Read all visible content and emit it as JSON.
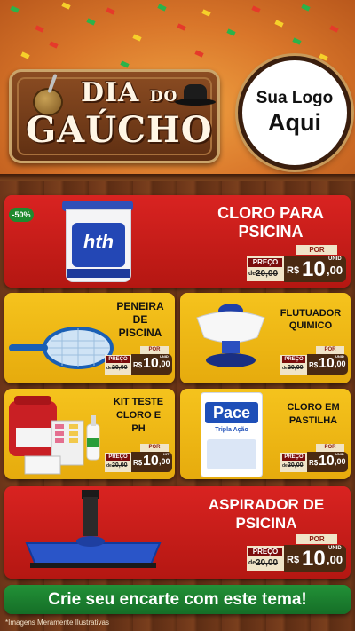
{
  "header": {
    "title_line1": "DIA",
    "title_small": "DO",
    "title_line2": "GAÚCHO",
    "logo_line1": "Sua Logo",
    "logo_line2": "Aqui"
  },
  "colors": {
    "red_card": "#d92321",
    "yellow_card": "#f5c31d",
    "green_button": "#229137",
    "wood": "#6b3519"
  },
  "products": [
    {
      "name_line1": "CLORO PARA",
      "name_line2": "PSICINA",
      "badge": "-50%",
      "por": "POR",
      "preco": "PREÇO",
      "de": "de",
      "old_price": "20,00",
      "currency": "R$",
      "price_int": "10",
      "price_dec": ",00",
      "unit": "UNID",
      "brand": "hth"
    },
    {
      "name_line1": "PENEIRA",
      "name_line2": "DE",
      "name_line3": "PISCINA",
      "por": "POR",
      "preco": "PREÇO",
      "de": "de",
      "old_price": "20,00",
      "currency": "R$",
      "price_int": "10",
      "price_dec": ",00",
      "unit": "UNID"
    },
    {
      "name_line1": "FLUTUADOR",
      "name_line2": "QUIMICO",
      "por": "POR",
      "preco": "PREÇO",
      "de": "de",
      "old_price": "20,00",
      "currency": "R$",
      "price_int": "10",
      "price_dec": ",00",
      "unit": "UNID"
    },
    {
      "name_line1": "KIT TESTE",
      "name_line2": "CLORO E",
      "name_line3": "PH",
      "por": "POR",
      "preco": "PREÇO",
      "de": "de",
      "old_price": "20,00",
      "currency": "R$",
      "price_int": "10",
      "price_dec": ",00",
      "unit": "KIT"
    },
    {
      "name_line1": "CLORO EM",
      "name_line2": "PASTILHA",
      "por": "POR",
      "preco": "PREÇO",
      "de": "de",
      "old_price": "20,00",
      "currency": "R$",
      "price_int": "10",
      "price_dec": ",00",
      "unit": "UNID",
      "brand": "Pace",
      "sub": "Tripla Ação"
    },
    {
      "name_line1": "ASPIRADOR DE",
      "name_line2": "PSICINA",
      "por": "POR",
      "preco": "PREÇO",
      "de": "de",
      "old_price": "20,00",
      "currency": "R$",
      "price_int": "10",
      "price_dec": ",00",
      "unit": "UNID"
    }
  ],
  "footer": {
    "cta": "Crie seu encarte com este tema!",
    "disclaimer": "*Imagens Meramente Ilustrativas"
  }
}
